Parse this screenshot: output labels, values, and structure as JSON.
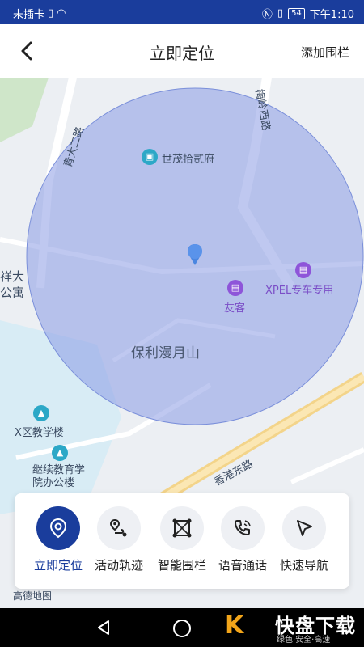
{
  "status": {
    "carrier": "未插卡",
    "battery": "54",
    "time": "下午1:10"
  },
  "header": {
    "title": "立即定位",
    "action": "添加围栏"
  },
  "map": {
    "labels": {
      "road_qingda": "青大二路",
      "road_meiling": "梅岭西路",
      "poi_shimao": "世茂拾贰府",
      "poi_xpel": "XPEL专车专用",
      "poi_youke": "友客",
      "area_baoli": "保利漫月山",
      "area_xiangda": "祥大公寓",
      "poi_xqu": "X区教学楼",
      "poi_jixu": "继续教育学院办公楼",
      "road_xianggang": "香港东路",
      "logo": "高德地图"
    }
  },
  "toolbar": {
    "items": [
      {
        "label": "立即定位",
        "icon": "location-pin-icon"
      },
      {
        "label": "活动轨迹",
        "icon": "route-icon"
      },
      {
        "label": "智能围栏",
        "icon": "fence-icon"
      },
      {
        "label": "语音通话",
        "icon": "phone-icon"
      },
      {
        "label": "快速导航",
        "icon": "navigation-arrow-icon"
      }
    ]
  },
  "watermark": {
    "text": "快盘下载",
    "sub": "绿色·安全·高速"
  },
  "colors": {
    "primary": "#1a3d9c",
    "fence": "#8a9be3"
  }
}
